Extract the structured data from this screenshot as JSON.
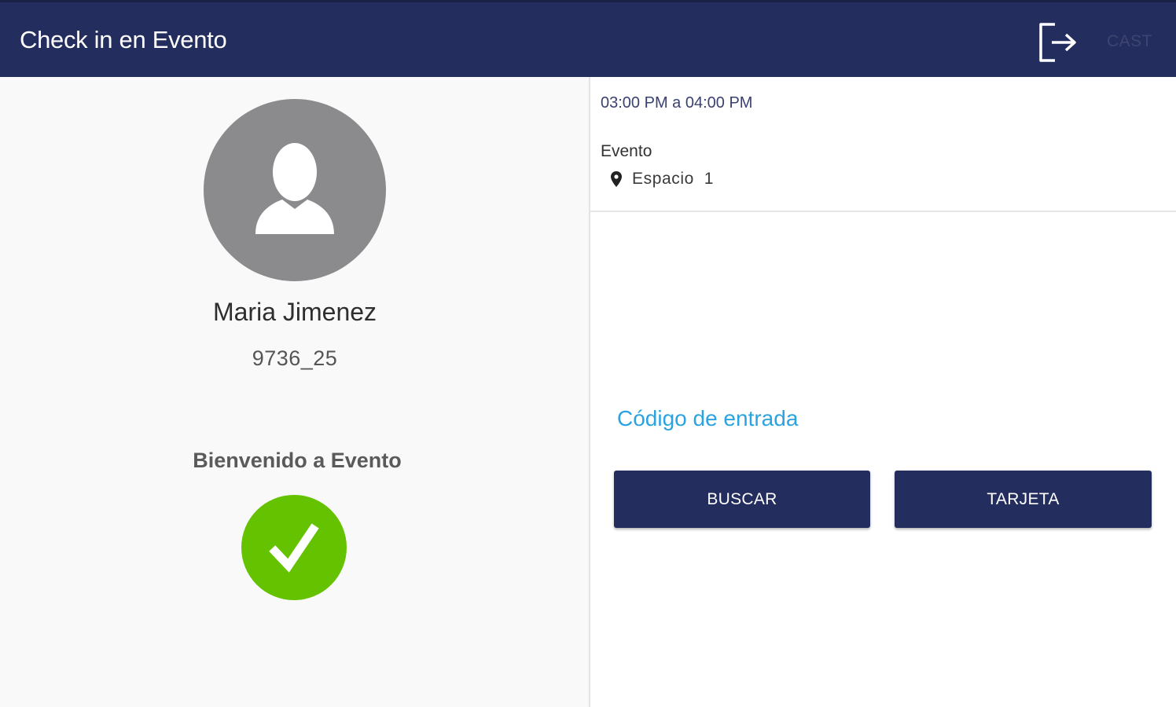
{
  "appbar": {
    "title": "Check in en Evento",
    "exit_icon": "exit-icon",
    "cast_label": "CAST"
  },
  "colors": {
    "appbar": "#232d5e",
    "button": "#232d5e",
    "success": "#65c200",
    "link": "#2aa3e0",
    "avatar": "#8b8b8e"
  },
  "attendee": {
    "avatar_icon": "person-icon",
    "name": "Maria Jimenez",
    "id": "9736_25",
    "welcome": "Bienvenido a Evento",
    "status_icon": "checkmark-icon"
  },
  "event": {
    "time": "03:00 PM a 04:00 PM",
    "name": "Evento",
    "location_icon": "location-pin-icon",
    "location": "Espacio  1"
  },
  "checkin": {
    "code_placeholder": "Código de entrada",
    "code_value": "",
    "search_button": "BUSCAR",
    "card_button": "TARJETA"
  }
}
